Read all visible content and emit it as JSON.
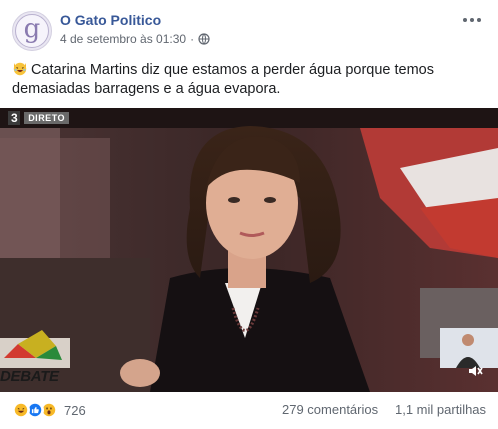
{
  "post": {
    "page_name": "O Gato Politico",
    "avatar_letter": "g",
    "date": "4 de setembro às 01:30",
    "separator": "·",
    "privacy_icon": "globe-icon",
    "more_icon": "ellipsis-icon",
    "text": "Catarina Martins diz que estamos a perder água porque temos demasiadas barragens e a água evapora.",
    "text_emoji": "cat-face-laughing-icon"
  },
  "video": {
    "channel_number": "3",
    "live_label": "DIRETO",
    "program_label": "DEBATE",
    "mute_icon": "speaker-muted-icon"
  },
  "footer": {
    "reaction_icons": [
      "haha-icon",
      "like-icon",
      "wow-icon"
    ],
    "reaction_count": "726",
    "comments": "279 comentários",
    "shares": "1,1 mil partilhas"
  },
  "colors": {
    "link": "#385898",
    "meta": "#616770",
    "like_blue": "#1877f2",
    "haha_yellow": "#f7b928"
  }
}
